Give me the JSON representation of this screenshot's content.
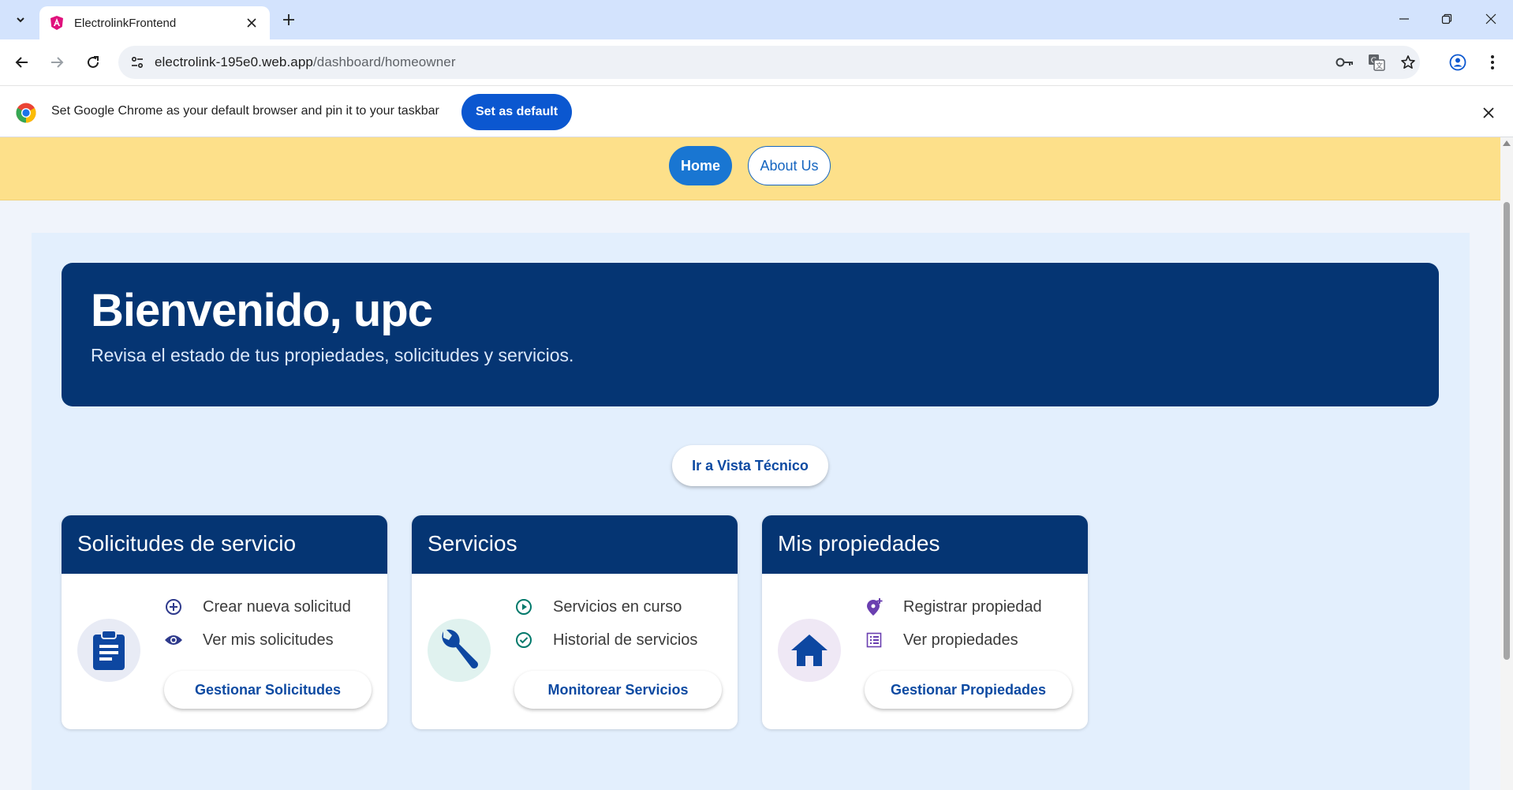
{
  "browser": {
    "tab_title": "ElectrolinkFrontend",
    "url_host": "electrolink-195e0.web.app",
    "url_path": "/dashboard/homeowner",
    "infobar_text": "Set Google Chrome as your default browser and pin it to your taskbar",
    "infobar_button": "Set as default"
  },
  "nav": {
    "home": "Home",
    "about": "About Us"
  },
  "hero": {
    "title": "Bienvenido, upc",
    "subtitle": "Revisa el estado de tus propiedades, solicitudes y servicios."
  },
  "tech_button": "Ir a Vista Técnico",
  "cards": [
    {
      "title": "Solicitudes de servicio",
      "main_icon": "clipboard-icon",
      "items": [
        {
          "icon": "add-circle-icon",
          "label": "Crear nueva solicitud"
        },
        {
          "icon": "eye-icon",
          "label": "Ver mis solicitudes"
        }
      ],
      "button": "Gestionar Solicitudes"
    },
    {
      "title": "Servicios",
      "main_icon": "wrench-icon",
      "items": [
        {
          "icon": "play-circle-icon",
          "label": "Servicios en curso"
        },
        {
          "icon": "check-circle-icon",
          "label": "Historial de servicios"
        }
      ],
      "button": "Monitorear Servicios"
    },
    {
      "title": "Mis propiedades",
      "main_icon": "house-icon",
      "items": [
        {
          "icon": "add-location-icon",
          "label": "Registrar propiedad"
        },
        {
          "icon": "list-icon",
          "label": "Ver propiedades"
        }
      ],
      "button": "Gestionar Propiedades"
    }
  ],
  "colors": {
    "brand_dark": "#053573",
    "primary_blue": "#1976d2",
    "navbar_yellow": "#fde08a",
    "panel_bg": "#e3effd",
    "card_icon_bg_1": "#e8ebf5",
    "card_icon_bg_2": "#e0f2ef",
    "card_icon_bg_3": "#efe8f5"
  }
}
